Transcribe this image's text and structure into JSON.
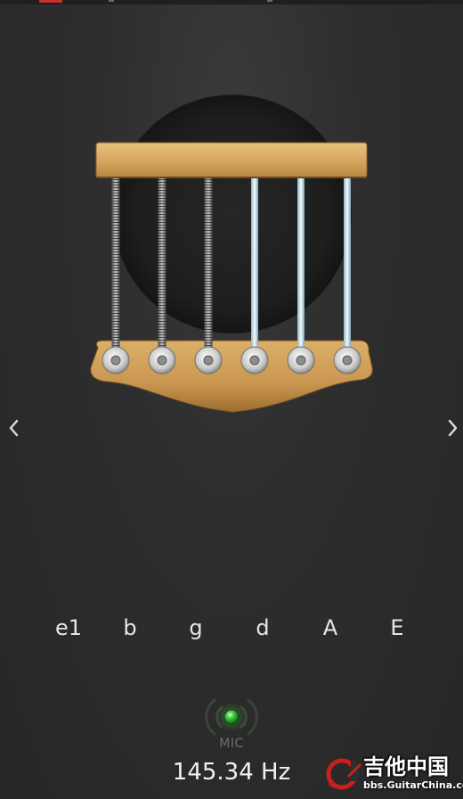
{
  "status_bar": {
    "accent_color": "#c9302c"
  },
  "tuner": {
    "string_notes": [
      "e1",
      "b",
      "g",
      "d",
      "A",
      "E"
    ],
    "nav": {
      "prev_icon": "chevron-left-icon",
      "next_icon": "chevron-right-icon"
    },
    "mic": {
      "label": "MIC",
      "indicator_color": "#3ec93e",
      "icon": "mic-signal-icon"
    },
    "frequency": "145.34 Hz"
  },
  "colors": {
    "background": "#2e2e2e",
    "wood": "#d4a55e",
    "wound_string": "#9a9a9a",
    "plain_string": "#cfe6f2",
    "note_text": "#e6e6e6"
  },
  "watermark": {
    "title": "吉他中国",
    "url": "bbs.GuitarChina.com"
  }
}
